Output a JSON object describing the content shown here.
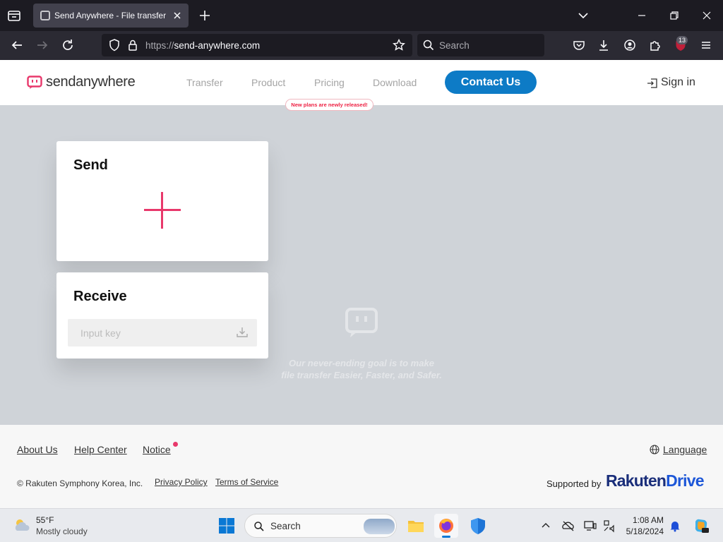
{
  "browser": {
    "tab_title": "Send Anywhere - File transfer",
    "url_protocol": "https://",
    "url_host": "send-anywhere.com",
    "search_placeholder": "Search",
    "extension_badge": "13"
  },
  "site": {
    "logo_text": "sendanywhere",
    "nav": [
      "Transfer",
      "Product",
      "Pricing",
      "Download"
    ],
    "contact_label": "Contact Us",
    "signin_label": "Sign in",
    "promo_badge": "New plans are newly released!",
    "accent_color": "#0d7bc6",
    "brand_color": "#e8386b"
  },
  "main": {
    "send_title": "Send",
    "receive_title": "Receive",
    "input_placeholder": "Input key",
    "tagline_line1": "Our never-ending goal is to make",
    "tagline_line2": "file transfer Easier, Faster, and Safer."
  },
  "footer": {
    "links": [
      "About Us",
      "Help Center",
      "Notice"
    ],
    "language_label": "Language",
    "copyright": "© Rakuten Symphony Korea, Inc.",
    "privacy": "Privacy Policy",
    "terms": "Terms of Service",
    "supported_by": "Supported by",
    "brand_1": "Rakuten",
    "brand_2": "Drive"
  },
  "taskbar": {
    "temperature": "55°F",
    "condition": "Mostly cloudy",
    "search_label": "Search",
    "time": "1:08 AM",
    "date": "5/18/2024"
  }
}
